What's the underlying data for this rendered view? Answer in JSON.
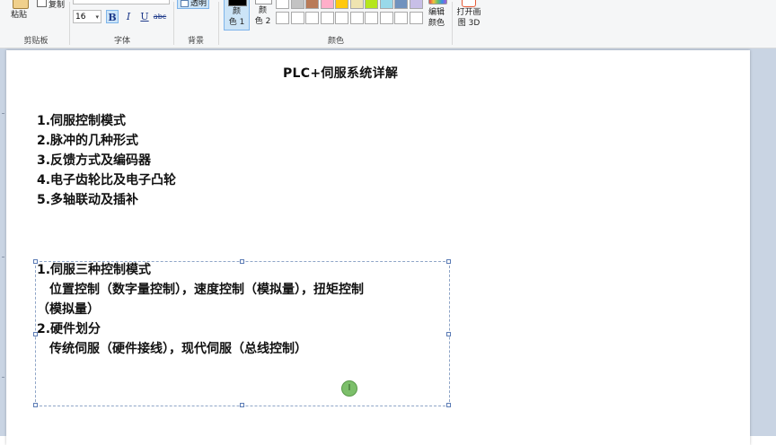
{
  "ribbon": {
    "clipboard": {
      "paste_label": "粘贴",
      "copy_label": "复制",
      "group_label": "剪贴板"
    },
    "font": {
      "size_value": "16",
      "bold_label": "B",
      "italic_label": "I",
      "underline_label": "U",
      "strikethrough_label": "abc",
      "group_label": "字体"
    },
    "background": {
      "transparent_label": "透明",
      "group_label": "背景"
    },
    "colors": {
      "color1_label": "颜\n色 1",
      "color1_line1": "颜",
      "color1_line2": "色 1",
      "color2_line1": "颜",
      "color2_line2": "色 2",
      "edit_line1": "编辑",
      "edit_line2": "颜色",
      "group_label": "颜色",
      "color1_value": "#000000",
      "color2_value": "#ffffff",
      "palette_row1": [
        "#ffffff",
        "#c3c3c3",
        "#b97a57",
        "#ffaec9",
        "#ffc90e",
        "#efe4b0",
        "#b5e61d",
        "#99d9ea",
        "#7092be",
        "#c8bfe7"
      ],
      "palette_row2": [
        "#ffffff",
        "#ffffff",
        "#ffffff",
        "#ffffff",
        "#ffffff",
        "#ffffff",
        "#ffffff",
        "#ffffff",
        "#ffffff",
        "#ffffff"
      ]
    },
    "paint3d": {
      "line1": "打开画",
      "line2": "图 3D"
    }
  },
  "document": {
    "title": "PLC+伺服系统详解",
    "outline": [
      "1.伺服控制模式",
      "2.脉冲的几种形式",
      "3.反馈方式及编码器",
      "4.电子齿轮比及电子凸轮",
      "5.多轴联动及插补"
    ],
    "textbox_lines": [
      {
        "text": "1.伺服三种控制模式",
        "indent": false
      },
      {
        "text": "位置控制（数字量控制），速度控制（模拟量），扭矩控制",
        "indent": true
      },
      {
        "text": "（模拟量）",
        "indent": false
      },
      {
        "text": "2.硬件划分",
        "indent": false
      },
      {
        "text": "传统伺服（硬件接线），现代伺服（总线控制）",
        "indent": true
      }
    ]
  }
}
